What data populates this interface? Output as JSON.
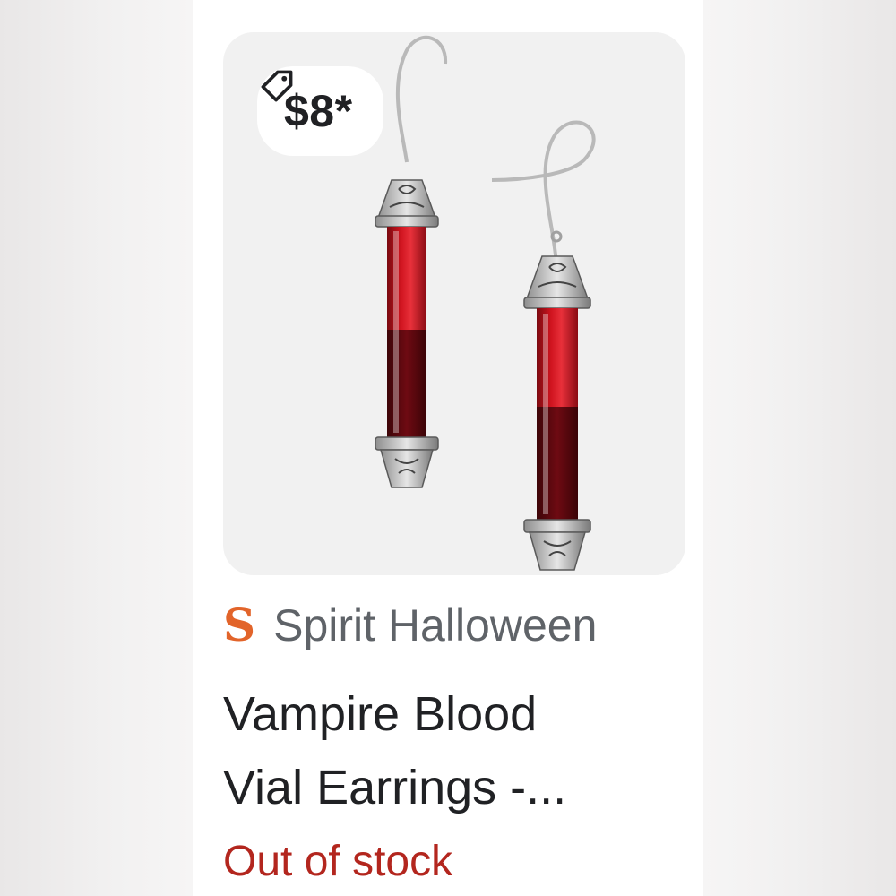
{
  "product_card": {
    "price": "$8*",
    "price_icon": "tag-icon",
    "merchant": {
      "logo_letter": "S",
      "name": "Spirit Halloween",
      "logo_color": "#e2642a"
    },
    "title_lines": [
      "Vampire Blood",
      "Vial Earrings -..."
    ],
    "availability": "Out of stock",
    "availability_color": "#b3261e",
    "image_description_icon": "vampire-blood-vial-earrings-image"
  }
}
